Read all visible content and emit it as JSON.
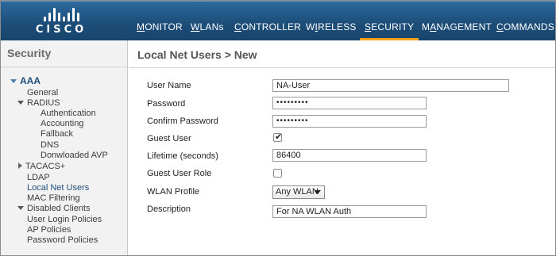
{
  "brand": {
    "logo_text": "CISCO",
    "colors": {
      "header": "#1d4f7a",
      "active_tab": "#f7a21b",
      "link": "#1f4e79"
    }
  },
  "nav": {
    "items": [
      {
        "first": "M",
        "rest": "ONITOR"
      },
      {
        "first": "W",
        "rest": "LANs"
      },
      {
        "first": "C",
        "rest": "ONTROLLER"
      },
      {
        "first": "W",
        "rest": "IRELESS",
        "pre": "",
        "note": "underline on I"
      },
      {
        "first": "S",
        "rest": "ECURITY"
      },
      {
        "first": "M",
        "rest": "ANAGEMENT"
      },
      {
        "first": "C",
        "rest": "OMMANDS"
      }
    ],
    "labels": [
      "MONITOR",
      "WLANs",
      "CONTROLLER",
      "WIRELESS",
      "SECURITY",
      "MANAGEMENT",
      "COMMANDS"
    ],
    "active": "SECURITY"
  },
  "sidebar": {
    "title": "Security",
    "items": [
      {
        "label": "AAA",
        "type": "section-open"
      },
      {
        "label": "General"
      },
      {
        "label": "RADIUS",
        "type": "group-open"
      },
      {
        "label": "Authentication"
      },
      {
        "label": "Accounting"
      },
      {
        "label": "Fallback"
      },
      {
        "label": "DNS"
      },
      {
        "label": "Donwloaded AVP"
      },
      {
        "label": "TACACS+",
        "type": "group-closed"
      },
      {
        "label": "LDAP"
      },
      {
        "label": "Local Net Users",
        "type": "selected"
      },
      {
        "label": "MAC Filtering"
      },
      {
        "label": "Disabled Clients",
        "type": "group-open"
      },
      {
        "label": "User Login Policies"
      },
      {
        "label": "AP Policies"
      },
      {
        "label": "Password Policies"
      }
    ]
  },
  "main": {
    "title": "Local Net Users > New",
    "form": {
      "user_name": {
        "label": "User Name",
        "value": "NA-User"
      },
      "password": {
        "label": "Password",
        "value": "•••••••••"
      },
      "confirm_password": {
        "label": "Confirm Password",
        "value": "•••••••••"
      },
      "guest_user": {
        "label": "Guest User",
        "checked": true
      },
      "lifetime": {
        "label": "Lifetime (seconds)",
        "value": "86400"
      },
      "guest_user_role": {
        "label": "Guest User Role",
        "checked": false
      },
      "wlan_profile": {
        "label": "WLAN Profile",
        "value": "Any WLAN"
      },
      "description": {
        "label": "Description",
        "value": "For NA WLAN Auth"
      }
    }
  }
}
